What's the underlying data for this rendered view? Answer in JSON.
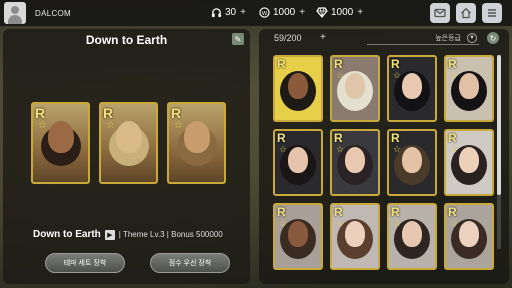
{
  "user": {
    "name": "DALCOM"
  },
  "currencies": [
    {
      "icon": "headphones-icon",
      "value": "30"
    },
    {
      "icon": "coin-icon",
      "value": "1000"
    },
    {
      "icon": "diamond-icon",
      "value": "1000"
    }
  ],
  "top_buttons": [
    "mail-icon",
    "home-icon",
    "menu-icon"
  ],
  "theme": {
    "title": "Down to Earth",
    "name": "Down to Earth",
    "meta": "| Theme Lv.3 | Bonus 500000",
    "button_equip_set": "테마 세트 장착",
    "button_equip_priority": "점수 우선 장착",
    "cards": [
      {
        "rarity": "R",
        "tone": "#9b6a44",
        "hair": "#2a1e16"
      },
      {
        "rarity": "R",
        "tone": "#d9b98a",
        "hair": "#c8b07a"
      },
      {
        "rarity": "R",
        "tone": "#c99c6e",
        "hair": "#8a6a40"
      }
    ]
  },
  "collection": {
    "count": "59/200",
    "sort_label": "높은등급",
    "scroll_fraction": 0.72,
    "cards": [
      {
        "rarity": "R",
        "bg": "#e6d04a",
        "tone": "#8a5a3a",
        "hair": "#1e1a16"
      },
      {
        "rarity": "R",
        "bg": "#8a7a70",
        "tone": "#e0c6a8",
        "hair": "#e4e0d0"
      },
      {
        "rarity": "R",
        "bg": "#2a2a2e",
        "tone": "#e8c8b0",
        "hair": "#121214"
      },
      {
        "rarity": "R",
        "bg": "#c9c0b0",
        "tone": "#e2c0a4",
        "hair": "#141214"
      },
      {
        "rarity": "R",
        "bg": "#2a2a2e",
        "tone": "#e6c4ac",
        "hair": "#1a1618"
      },
      {
        "rarity": "R",
        "bg": "#3a3a3e",
        "tone": "#e8c8ae",
        "hair": "#2a2224"
      },
      {
        "rarity": "R",
        "bg": "#2a2a2c",
        "tone": "#e4c2a6",
        "hair": "#4a3a2a"
      },
      {
        "rarity": "R",
        "bg": "#cfcac4",
        "tone": "#ecd0ba",
        "hair": "#2a2220"
      },
      {
        "rarity": "R",
        "bg": "#a8a098",
        "tone": "#8a5a3e",
        "hair": "#3a2c22"
      },
      {
        "rarity": "R",
        "bg": "#c0b8b2",
        "tone": "#ecd0bc",
        "hair": "#5a3e2e"
      },
      {
        "rarity": "R",
        "bg": "#b8b2aa",
        "tone": "#e6c8b0",
        "hair": "#2e2420"
      },
      {
        "rarity": "R",
        "bg": "#aaa49c",
        "tone": "#ecd2be",
        "hair": "#3a2c24"
      }
    ]
  }
}
